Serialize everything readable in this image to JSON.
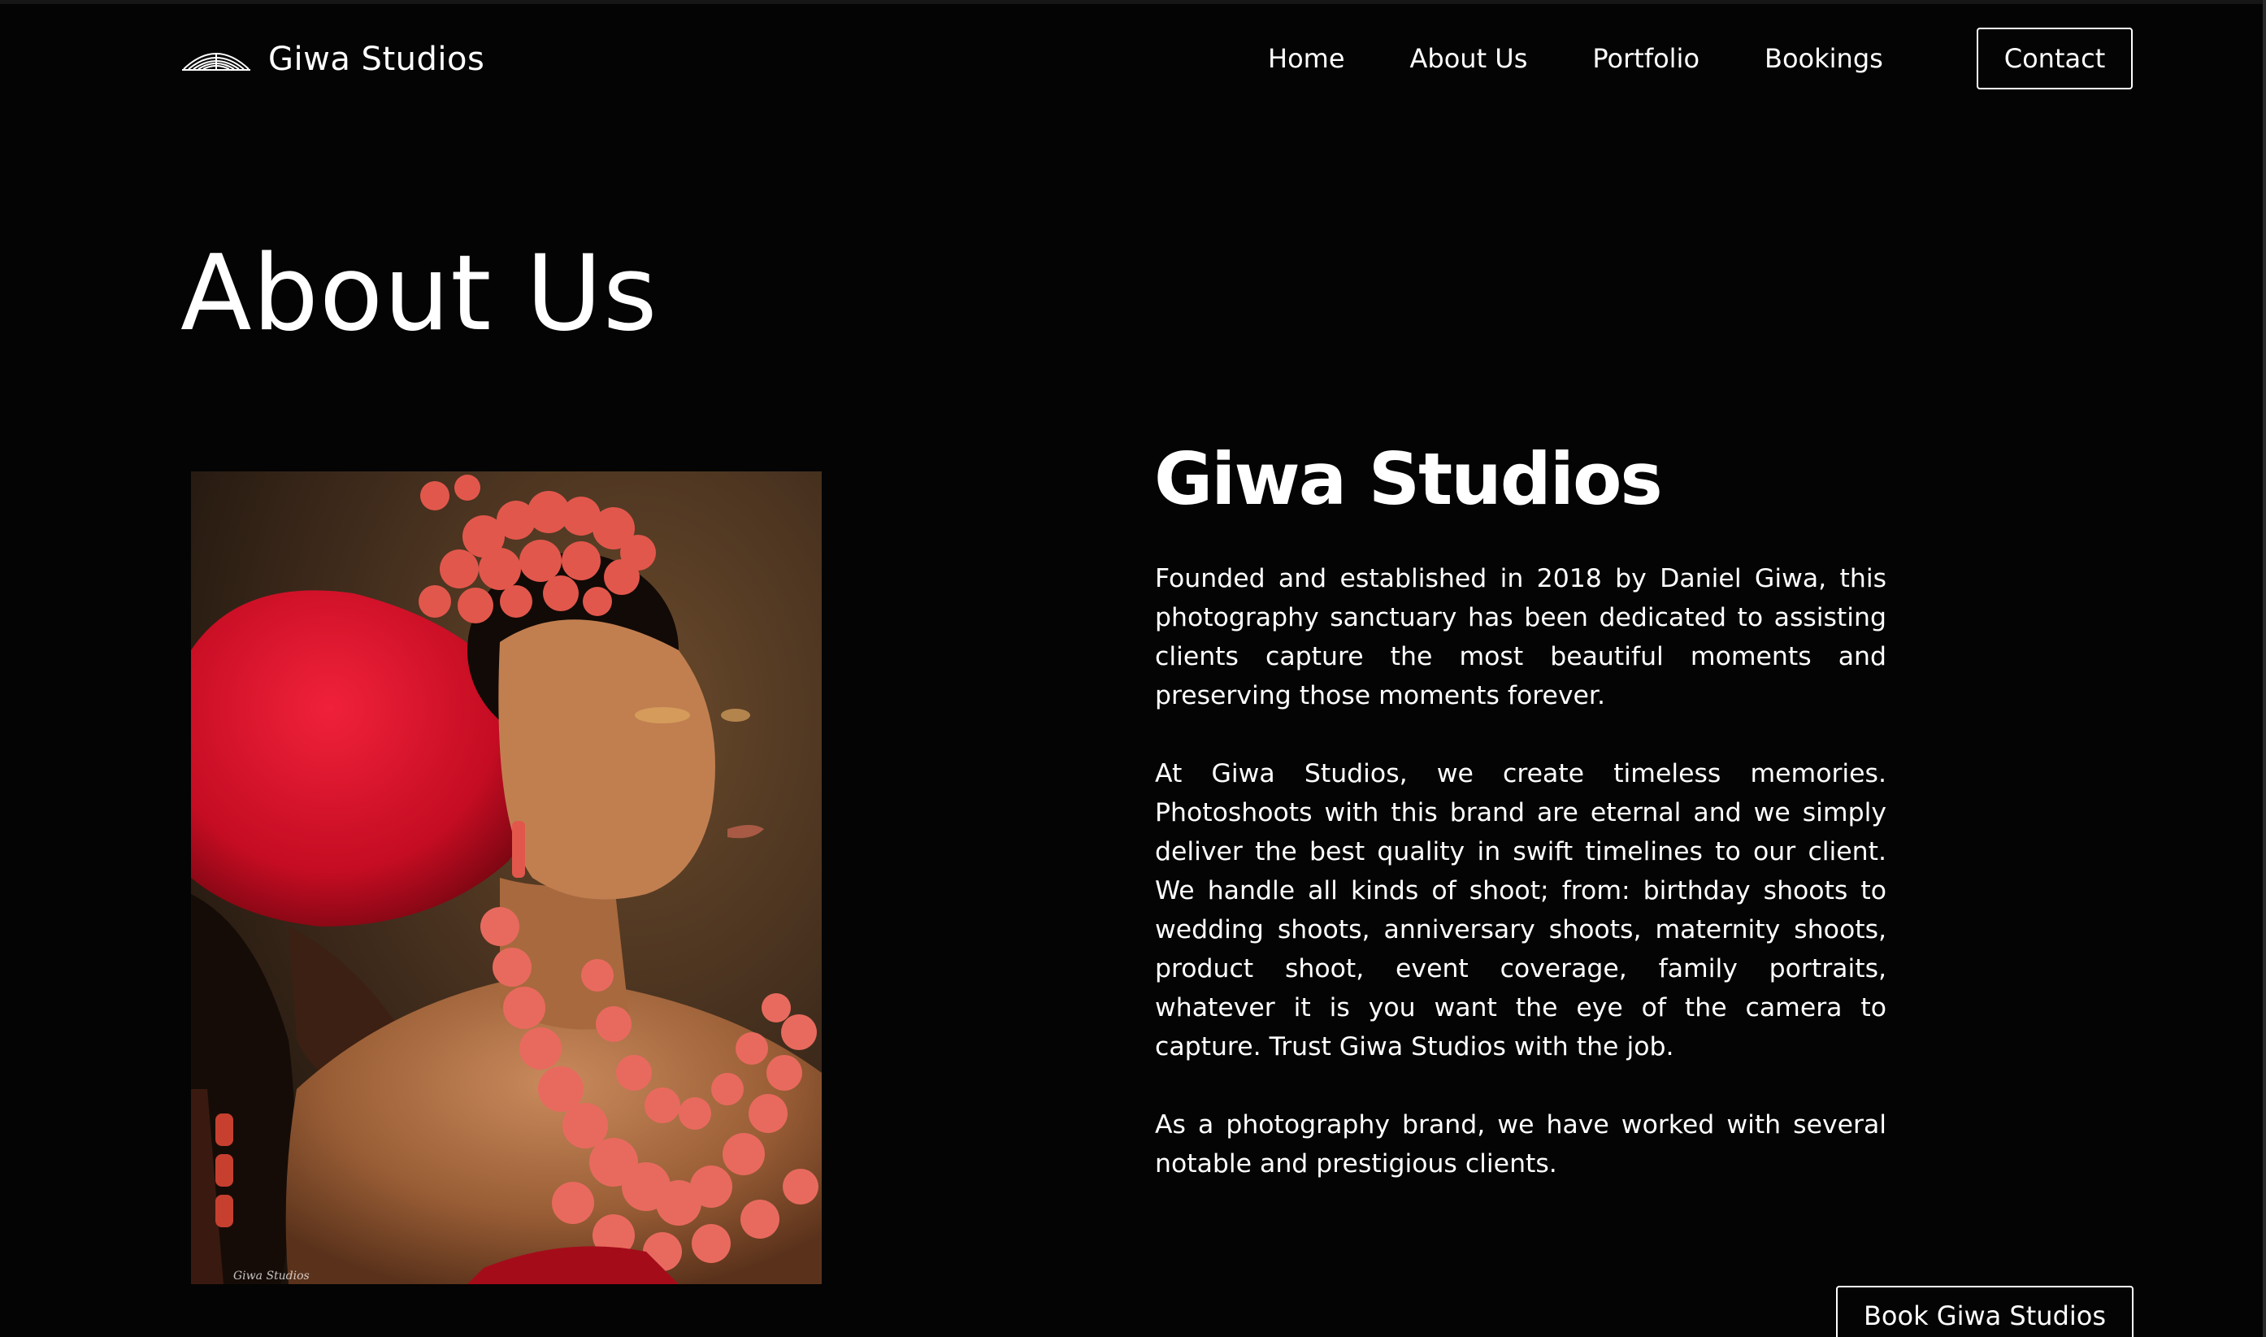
{
  "header": {
    "logo_icon": "scallop-shell-icon",
    "brand_name": "Giwa Studios",
    "nav": [
      {
        "label": "Home"
      },
      {
        "label": "About Us"
      },
      {
        "label": "Portfolio"
      },
      {
        "label": "Bookings"
      }
    ],
    "contact_label": "Contact"
  },
  "page": {
    "title": "About Us"
  },
  "photo": {
    "signature": "Giwa Studios",
    "subject": "bride-in-coral-beads-portrait"
  },
  "about": {
    "heading": "Giwa Studios",
    "paragraphs": [
      "Founded and established in 2018 by Daniel Giwa, this photography sanctuary has been dedicated to assisting clients capture the most beautiful moments and preserving those moments forever.",
      "At Giwa Studios, we create timeless memories. Photoshoots with this brand are eternal and we simply deliver the best quality in swift timelines to our client. We handle all kinds of shoot; from: birthday shoots to wedding shoots, anniversary shoots, maternity shoots, product shoot, event coverage, family portraits, whatever it is you want the eye of the camera to capture. Trust Giwa Studios with the job.",
      "As a photography brand, we have worked with several notable and prestigious clients."
    ],
    "cta_label": "Book Giwa Studios"
  },
  "colors": {
    "background": "#040404",
    "text": "#ffffff"
  }
}
